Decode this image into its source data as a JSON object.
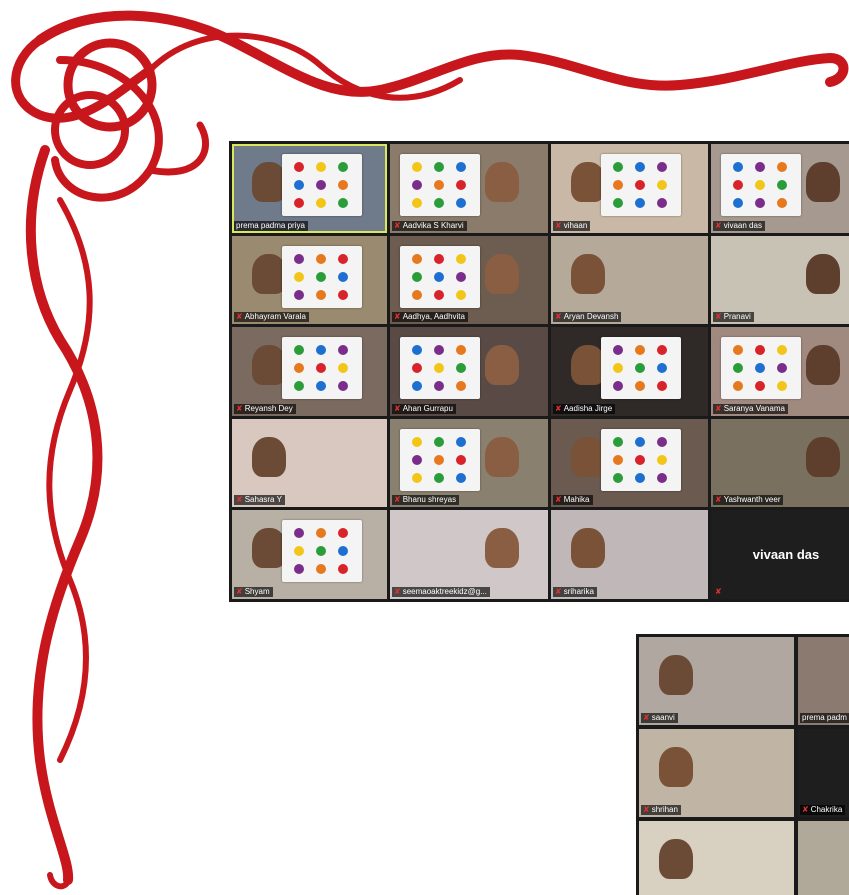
{
  "ornament": {
    "color": "#c8161d",
    "name": "celtic-knot-corner-ornament"
  },
  "main_grid": {
    "tiles": [
      {
        "name": "prema padma priya",
        "active": true,
        "muted": false,
        "bg": "#6f7a8a"
      },
      {
        "name": "Aadvika S Kharvi",
        "muted": true,
        "bg": "#8b7b6a"
      },
      {
        "name": "vihaan",
        "muted": true,
        "bg": "#c9b8a5"
      },
      {
        "name": "vivaan das",
        "muted": true,
        "bg": "#a69a90"
      },
      {
        "name": "Abhayram Varala",
        "muted": true,
        "bg": "#9a8a6f"
      },
      {
        "name": "Aadhya, Aadhvita",
        "muted": true,
        "bg": "#6d5d50"
      },
      {
        "name": "Aryan Devansh",
        "muted": true,
        "bg": "#b5aa9a"
      },
      {
        "name": "Pranavi",
        "muted": true,
        "bg": "#c8c2b5"
      },
      {
        "name": "Reyansh Dey",
        "muted": true,
        "bg": "#7a6a60"
      },
      {
        "name": "Ahan Gurrapu",
        "muted": true,
        "bg": "#5a4a45"
      },
      {
        "name": "Aadisha Jirge",
        "muted": true,
        "bg": "#2f2a28"
      },
      {
        "name": "Saranya Vanama",
        "muted": true,
        "bg": "#a08a80"
      },
      {
        "name": "Sahasra Y",
        "muted": true,
        "bg": "#d8c8c0"
      },
      {
        "name": "Bhanu shreyas",
        "muted": true,
        "bg": "#8a8070"
      },
      {
        "name": "Mahika",
        "muted": true,
        "bg": "#6a5a50"
      },
      {
        "name": "Yashwanth veer",
        "muted": true,
        "bg": "#7a7060"
      },
      {
        "name": "Shyam",
        "muted": true,
        "bg": "#b8b0a5"
      },
      {
        "name": "seemaoaktreekidz@g...",
        "muted": true,
        "bg": "#d0c8c8"
      },
      {
        "name": "sriharika",
        "muted": true,
        "bg": "#c0b8b8"
      },
      {
        "name": "",
        "muted": true,
        "bg": "#1e1e1e",
        "center_label": "vivaan das"
      }
    ]
  },
  "small_grid": {
    "tiles": [
      {
        "name": "saanvi",
        "muted": true,
        "bg": "#b0a8a0"
      },
      {
        "name": "prema padm",
        "muted": false,
        "bg": "#8a7a70"
      },
      {
        "name": "shrihan",
        "muted": true,
        "bg": "#c0b5a5"
      },
      {
        "name": "Chakrika",
        "muted": true,
        "bg": "#1e1e1e"
      },
      {
        "name": "",
        "muted": false,
        "bg": "#d8d0c0"
      },
      {
        "name": "",
        "muted": false,
        "bg": "#b0a898"
      }
    ]
  },
  "dot_colors": [
    "#d8232a",
    "#f2c618",
    "#2a9d3a",
    "#1d6fd0",
    "#7a2d8a",
    "#e6781e"
  ]
}
